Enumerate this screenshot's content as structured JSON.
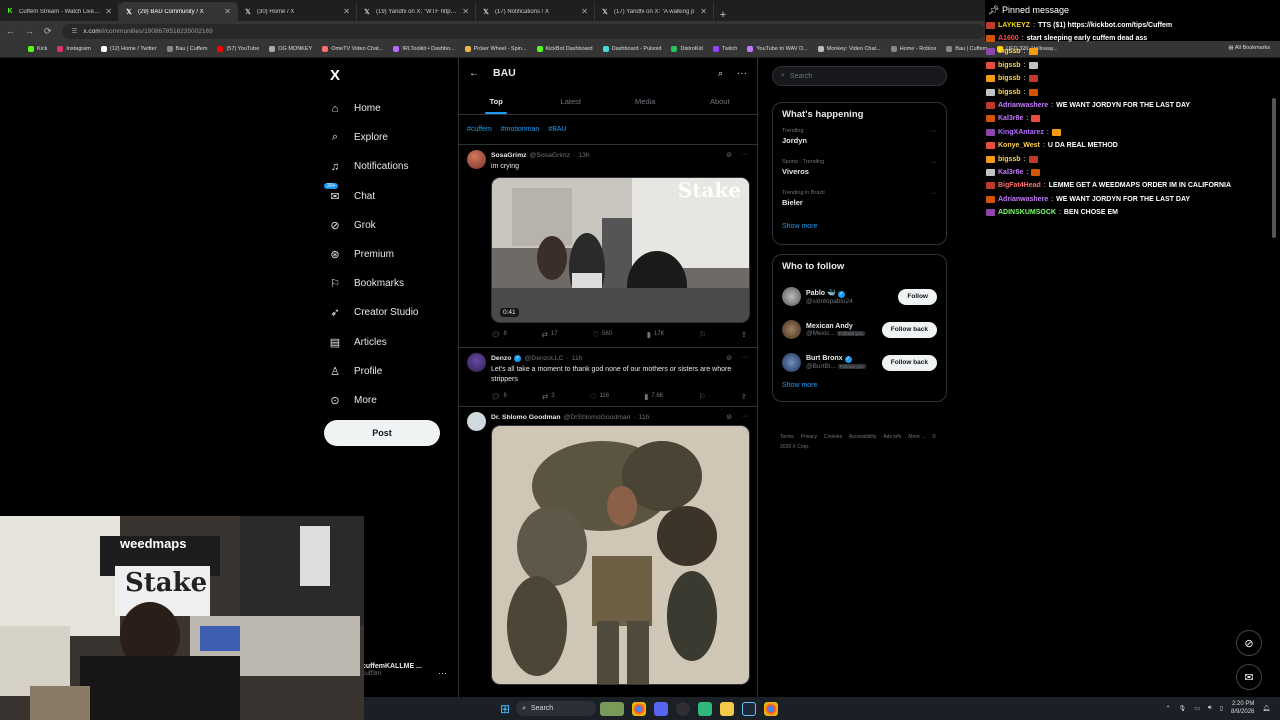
{
  "browser": {
    "tabs": [
      {
        "title": "Cuffem Stream - Watch Live on",
        "icon": "kick-icon",
        "active": false
      },
      {
        "title": "(29) BAU Community / X",
        "icon": "x-icon",
        "active": true
      },
      {
        "title": "(30) Home / X",
        "icon": "x-icon",
        "active": false
      },
      {
        "title": "(19) Yandhi on X: \"WTF https://",
        "icon": "x-icon",
        "active": false
      },
      {
        "title": "(17) Notifications / X",
        "icon": "x-icon",
        "active": false
      },
      {
        "title": "(17) Yandhi on X: \"A walking p",
        "icon": "x-icon",
        "active": false
      }
    ],
    "url_host": "x.com",
    "url_path": "/i/communities/1908678516235002169",
    "bookmarks": [
      "Kick",
      "Instagram",
      "(12) Home / Twitter",
      "Bau | Cuffem",
      "(57) YouTube",
      "OG MONKEY",
      "OmeTV Video Chat...",
      "IRLToolkit • Dashbo...",
      "Picker Wheel - Spin...",
      "KickBot Dashboard",
      "Dashboard - Pulsoid",
      "DistroKid",
      "Twitch",
      "YouTube to WAV D...",
      "Monkey: Video Chat...",
      "Home - Roblox",
      "Bau | Cuffem",
      "UFC 326: Holloway..."
    ],
    "all_bookmarks": "All Bookmarks"
  },
  "sidebar": {
    "logo": "X",
    "items": [
      {
        "label": "Home",
        "icon": "home-icon"
      },
      {
        "label": "Explore",
        "icon": "search-icon"
      },
      {
        "label": "Notifications",
        "icon": "bell-icon"
      },
      {
        "label": "Chat",
        "icon": "chat-icon",
        "badge": "20+"
      },
      {
        "label": "Grok",
        "icon": "grok-icon"
      },
      {
        "label": "Premium",
        "icon": "premium-icon"
      },
      {
        "label": "Bookmarks",
        "icon": "bookmark-icon"
      },
      {
        "label": "Creator Studio",
        "icon": "rocket-icon"
      },
      {
        "label": "Articles",
        "icon": "article-icon"
      },
      {
        "label": "Profile",
        "icon": "person-icon"
      },
      {
        "label": "More",
        "icon": "more-circle-icon"
      }
    ],
    "post_label": "Post",
    "account_name": "cuffemKALLME ...",
    "account_handle": "cuff3m"
  },
  "community": {
    "title": "BAU",
    "tabs": [
      "Top",
      "Latest",
      "Media",
      "About"
    ],
    "active_tab": "Top",
    "tags": [
      "#cuffem",
      "#motionman",
      "#BAU"
    ]
  },
  "tweets": [
    {
      "name": "SosaGrimz",
      "handle": "@SosaGrimz",
      "time": "13h",
      "verified": false,
      "text": "im crying",
      "video_time": "0:41",
      "replies": "8",
      "reposts": "17",
      "likes": "560",
      "views": "17K"
    },
    {
      "name": "Denzo",
      "handle": "@DenzoLLC",
      "time": "11h",
      "verified": true,
      "text": "Let's all take a moment to thank god none of our mothers or sisters are whore strippers",
      "replies": "6",
      "reposts": "3",
      "likes": "116",
      "views": "7.6K"
    },
    {
      "name": "Dr. Shlomo Goodman",
      "handle": "@DrShlomoGoodman",
      "time": "11h",
      "verified": false,
      "text": ""
    }
  ],
  "right": {
    "search_placeholder": "Search",
    "happening_title": "What's happening",
    "trends": [
      {
        "category": "Trending",
        "name": "Jordyn"
      },
      {
        "category": "Sports · Trending",
        "name": "Viveros"
      },
      {
        "category": "Trending in Brazil",
        "name": "Bieler"
      }
    ],
    "show_more": "Show more",
    "follow_title": "Who to follow",
    "follow": [
      {
        "name": "Pablo 🐳",
        "handle": "@sxintopablo24",
        "button": "Follow",
        "follows_you": ""
      },
      {
        "name": "Mexican Andy",
        "handle": "@Mexic...",
        "button": "Follow back",
        "follows_you": "Follows you"
      },
      {
        "name": "Burt Bronx",
        "handle": "@BurtBr...",
        "button": "Follow back",
        "follows_you": "Follows you"
      }
    ],
    "footer": [
      "Terms",
      "Privacy",
      "Cookies",
      "Accessibility",
      "Ads info",
      "More ...",
      "© 2026 X Corp."
    ]
  },
  "chat": {
    "pinned_label": "Pinned message",
    "messages": [
      {
        "user": "LAYKEYZ",
        "text": "TTS ($1) https://kickbot.com/tips/Cuffem",
        "color": "#f5d90a"
      },
      {
        "user": "A1600",
        "text": "start sleeping early cuffem dead ass",
        "color": "#ff4d4d"
      },
      {
        "user": "bigssb",
        "text": "",
        "color": "#ffd24d"
      },
      {
        "user": "bigssb",
        "text": "",
        "color": "#ffd24d"
      },
      {
        "user": "bigssb",
        "text": "",
        "color": "#ffd24d"
      },
      {
        "user": "bigssb",
        "text": "",
        "color": "#ffd24d"
      },
      {
        "user": "Adrianwashere",
        "text": "WE WANT JORDYN FOR THE LAST DAY",
        "color": "#c77dff"
      },
      {
        "user": "Kal3r8e",
        "text": "",
        "color": "#c77dff"
      },
      {
        "user": "KingXAntarez",
        "text": "",
        "color": "#b06cff"
      },
      {
        "user": "Konye_West",
        "text": "U DA REAL METHOD",
        "color": "#ffd24d"
      },
      {
        "user": "bigssb",
        "text": "",
        "color": "#ffd24d"
      },
      {
        "user": "Kal3r8e",
        "text": "",
        "color": "#c77dff"
      },
      {
        "user": "BigFat4Head",
        "text": "LEMME GET A WEEDMAPS ORDER IM IN CALIFORNIA",
        "color": "#ff6b6b"
      },
      {
        "user": "Adrianwashere",
        "text": "WE WANT JORDYN FOR THE LAST DAY",
        "color": "#c77dff"
      },
      {
        "user": "ADINSKUMSOCK",
        "text": "BEN CHOSE EM",
        "color": "#7bff6b"
      }
    ]
  },
  "webcam": {
    "banner_text": "weedmaps",
    "sign_text": "Stake"
  },
  "taskbar": {
    "search_label": "Search",
    "time": "2:20 PM",
    "date": "8/9/2026"
  },
  "colors": {
    "accent": "#1d9bf0",
    "background": "#000000",
    "border": "#2f3336"
  }
}
